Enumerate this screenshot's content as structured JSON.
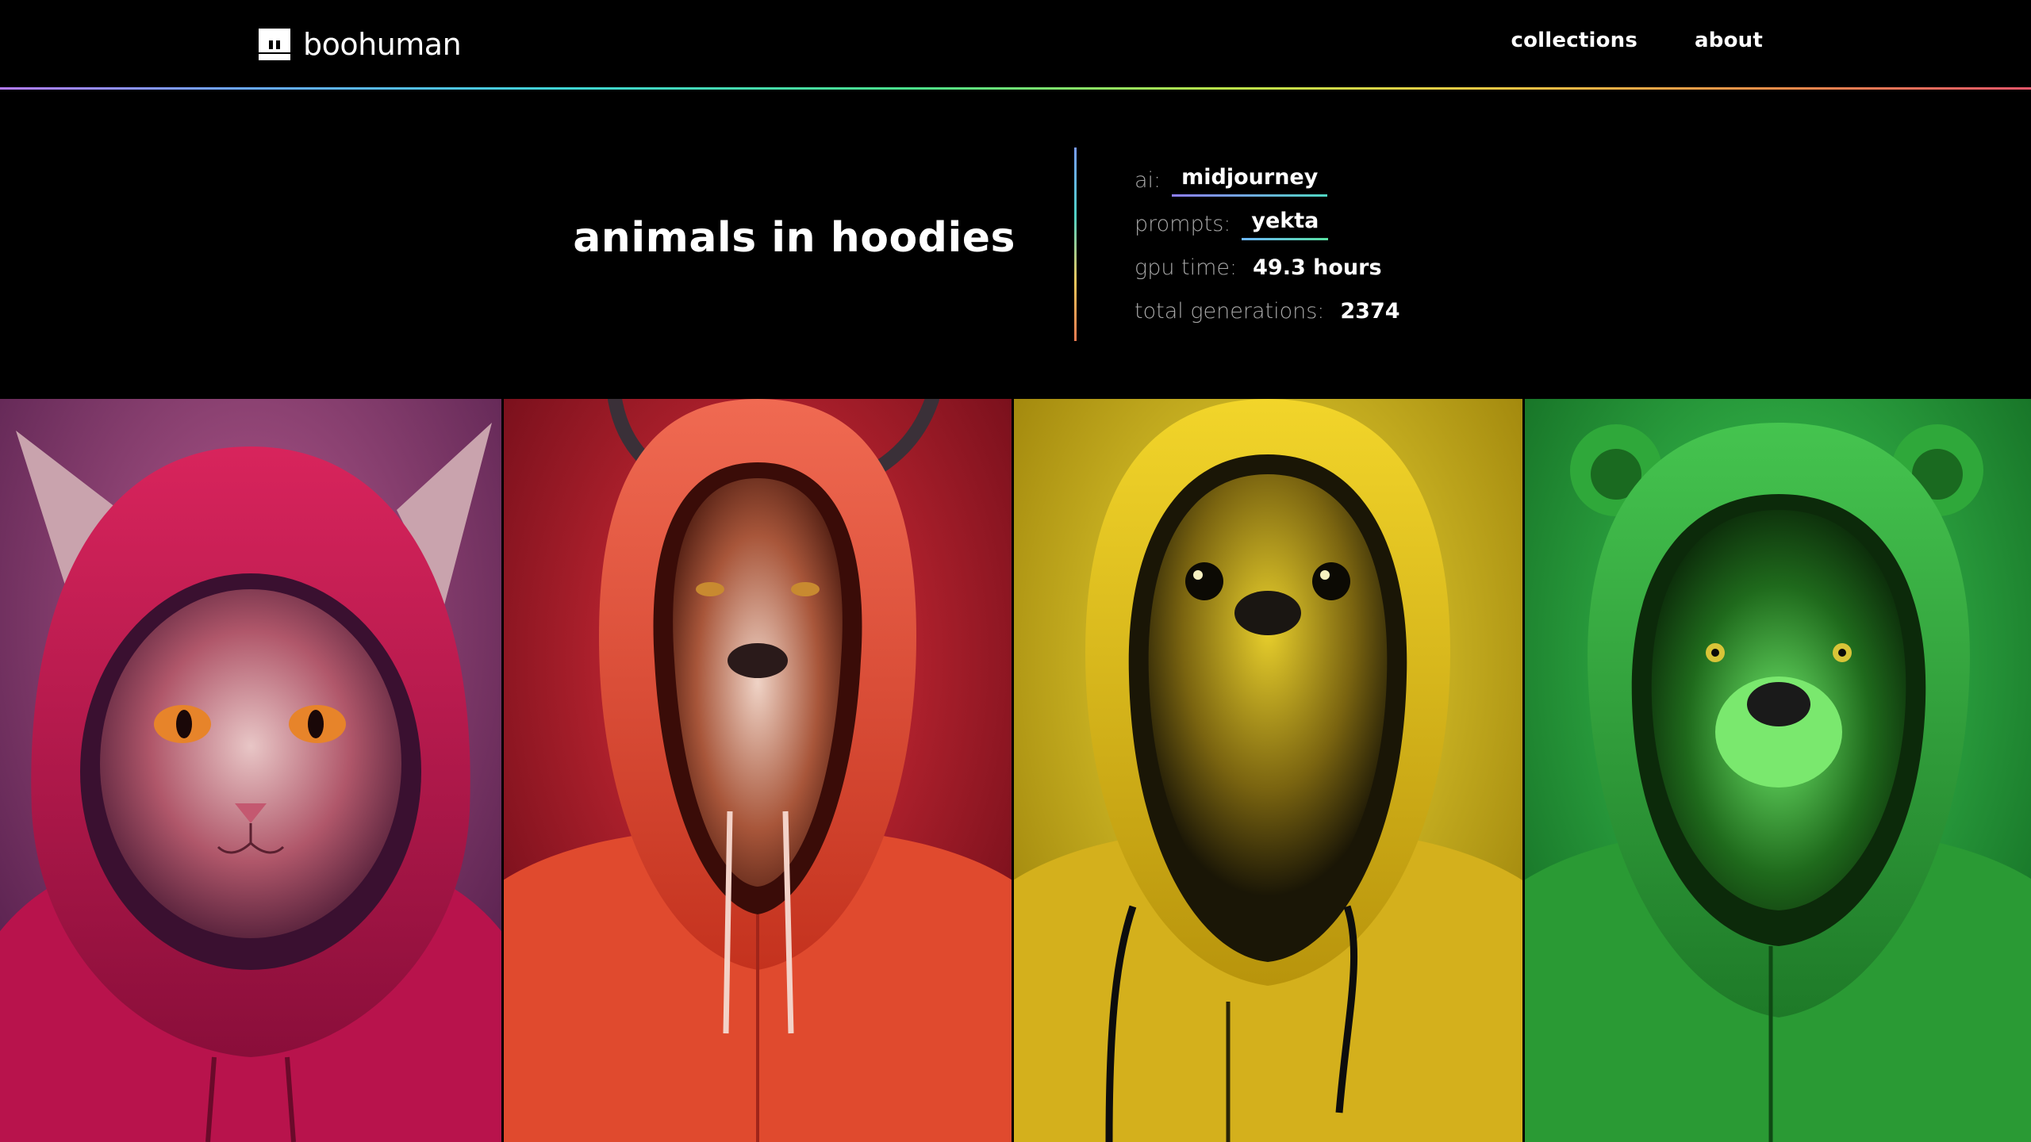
{
  "header": {
    "logo_text": "boohuman",
    "nav": [
      {
        "label": "collections"
      },
      {
        "label": "about"
      }
    ]
  },
  "hero": {
    "title": "animals in hoodies",
    "meta": {
      "ai_label": "ai:",
      "ai_value": "midjourney",
      "prompts_label": "prompts:",
      "prompts_value": "yekta",
      "gpu_label": "gpu time:",
      "gpu_value": "49.3 hours",
      "gen_label": "total generations:",
      "gen_value": "2374"
    }
  },
  "gallery": [
    {
      "subject": "cat in red hoodie",
      "hoodie_color": "#c3154e",
      "bg_color": "#7a2a5c"
    },
    {
      "subject": "goat in orange hoodie",
      "hoodie_color": "#d8402a",
      "bg_color": "#9e1024"
    },
    {
      "subject": "otter in yellow hoodie",
      "hoodie_color": "#d9b518",
      "bg_color": "#c9a800"
    },
    {
      "subject": "bear in green hoodie",
      "hoodie_color": "#2ea83a",
      "bg_color": "#178a2b"
    }
  ],
  "colors": {
    "background": "#000000",
    "text": "#ffffff",
    "muted": "#a8a8a8"
  }
}
